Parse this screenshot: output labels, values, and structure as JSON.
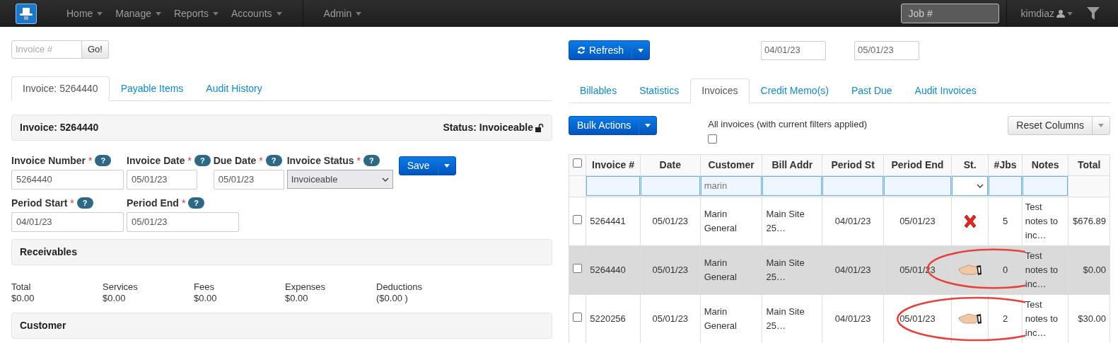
{
  "navbar": {
    "menu": [
      {
        "label": "Home",
        "dropdown": true
      },
      {
        "label": "Manage",
        "dropdown": true
      },
      {
        "label": "Reports",
        "dropdown": true
      },
      {
        "label": "Accounts",
        "dropdown": true
      },
      {
        "label": "Admin",
        "dropdown": true
      }
    ],
    "job_search": {
      "placeholder": "Job #"
    },
    "user": "kimdiaz"
  },
  "left": {
    "invoice_search": {
      "placeholder": "Invoice #",
      "button": "Go!"
    },
    "tabs": [
      {
        "label": "Invoice: 5264440",
        "selected": true
      },
      {
        "label": "Payable Items",
        "selected": false
      },
      {
        "label": "Audit History",
        "selected": false
      }
    ],
    "invoice_panel": {
      "title": "Invoice: 5264440",
      "status": "Status: Invoiceable",
      "locked": false
    },
    "fields_row_1": [
      {
        "label": "Invoice Number",
        "required_mark": "*",
        "help": "?",
        "value": "5264440",
        "kind": "text"
      },
      {
        "label": "Invoice Date",
        "required_mark": "*",
        "help": "?",
        "value": "05/01/23",
        "kind": "text"
      },
      {
        "label": "Due Date",
        "required_mark": "*",
        "help": "?",
        "value": "05/01/23",
        "kind": "text"
      },
      {
        "label": "Invoice Status",
        "required_mark": "*",
        "help": "?",
        "value": "Invoiceable",
        "kind": "select"
      }
    ],
    "save_button": "Save",
    "fields_row_2": [
      {
        "label": "Period Start",
        "required_mark": "*",
        "help": "?",
        "value": "04/01/23",
        "kind": "text"
      },
      {
        "label": "Period End",
        "required_mark": "*",
        "help": "?",
        "value": "05/01/23",
        "kind": "text"
      }
    ],
    "receivables": {
      "title": "Receivables",
      "totals": [
        {
          "label": "Total",
          "value": "$0.00"
        },
        {
          "label": "Services",
          "value": "$0.00"
        },
        {
          "label": "Fees",
          "value": "$0.00"
        },
        {
          "label": "Expenses",
          "value": "$0.00"
        },
        {
          "label": "Deductions",
          "value": "($0.00 )"
        }
      ]
    },
    "customer": {
      "title": "Customer"
    }
  },
  "right": {
    "refresh_button": "Refresh",
    "date_from": "04/01/23",
    "date_to": "05/01/23",
    "tabs": [
      {
        "label": "Billables",
        "selected": false
      },
      {
        "label": "Statistics",
        "selected": false
      },
      {
        "label": "Invoices",
        "selected": true
      },
      {
        "label": "Credit Memo(s)",
        "selected": false
      },
      {
        "label": "Past Due",
        "selected": false
      },
      {
        "label": "Audit Invoices",
        "selected": false
      }
    ],
    "bulk_actions": "Bulk Actions",
    "all_invoices": {
      "label": "All invoices (with current filters applied)",
      "checked": false
    },
    "reset_columns": "Reset Columns",
    "table": {
      "select_all": false,
      "columns": [
        "Invoice #",
        "Date",
        "Customer",
        "Bill Addr",
        "Period St",
        "Period End",
        "St.",
        "#Jbs",
        "Notes",
        "Total"
      ],
      "filters": {
        "customer": "marin"
      },
      "rows": [
        {
          "checked": false,
          "selected": false,
          "invoice": "5264441",
          "date": "05/01/23",
          "customer": "Marin General",
          "bill_addr": "Main Site 25…",
          "period_st": "04/01/23",
          "period_end": "05/01/23",
          "status": {
            "kind": "rejected"
          },
          "jobs": "5",
          "notes": "Test notes to inc…",
          "total": "$676.89"
        },
        {
          "checked": false,
          "selected": true,
          "invoice": "5264440",
          "date": "05/01/23",
          "customer": "Marin General",
          "bill_addr": "Main Site 25…",
          "period_st": "04/01/23",
          "period_end": "05/01/23",
          "status": {
            "kind": "hand"
          },
          "jobs": "0",
          "notes": "Test notes to inc…",
          "total": "$0.00",
          "annotation": {
            "kind": "right"
          }
        },
        {
          "checked": false,
          "selected": false,
          "invoice": "5220256",
          "date": "05/01/23",
          "customer": "Marin General",
          "bill_addr": "Main Site 25…",
          "period_st": "04/01/23",
          "period_end": "05/01/23",
          "status": {
            "kind": "hand"
          },
          "jobs": "2",
          "notes": "Test notes to inc…",
          "total": "$30.00",
          "annotation": {
            "kind": "left"
          }
        }
      ]
    }
  }
}
